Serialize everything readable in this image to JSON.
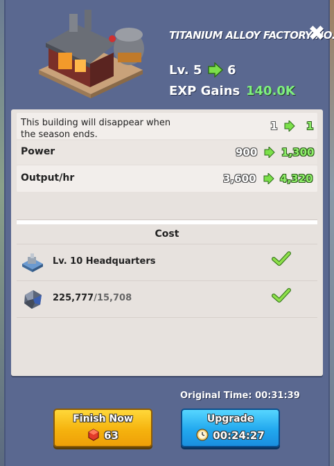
{
  "dialog": {
    "title": "TITANIUM ALLOY FACTORY NO.1",
    "close_icon": "close-icon"
  },
  "level": {
    "label": "Lv. 5",
    "next": "6",
    "exp_label": "EXP Gains",
    "exp_value": "140.0K"
  },
  "stats": [
    {
      "label": "This building will disappear when the season ends.",
      "old": "1",
      "new": "1"
    },
    {
      "label": "Power",
      "old": "900",
      "new": "1,300"
    },
    {
      "label": "Output/hr",
      "old": "3,600",
      "new": "4,320"
    }
  ],
  "cost": {
    "header": "Cost",
    "items": [
      {
        "icon": "headquarters-icon",
        "label": "Lv. 10 Headquarters",
        "met": true
      },
      {
        "icon": "titanium-ore-icon",
        "have": "225,777",
        "need": "/15,708",
        "met": true
      }
    ]
  },
  "original_time_label": "Original Time: 00:31:39",
  "buttons": {
    "finish": {
      "title": "Finish Now",
      "cost": "63",
      "icon": "gem-icon"
    },
    "upgrade": {
      "title": "Upgrade",
      "time": "00:24:27",
      "icon": "clock-icon"
    }
  },
  "colors": {
    "accent_green": "#7ff07f",
    "finish_button": "#f5b30e",
    "upgrade_button": "#22a8ee",
    "panel": "#e7e2de",
    "frame": "#5a6890"
  }
}
